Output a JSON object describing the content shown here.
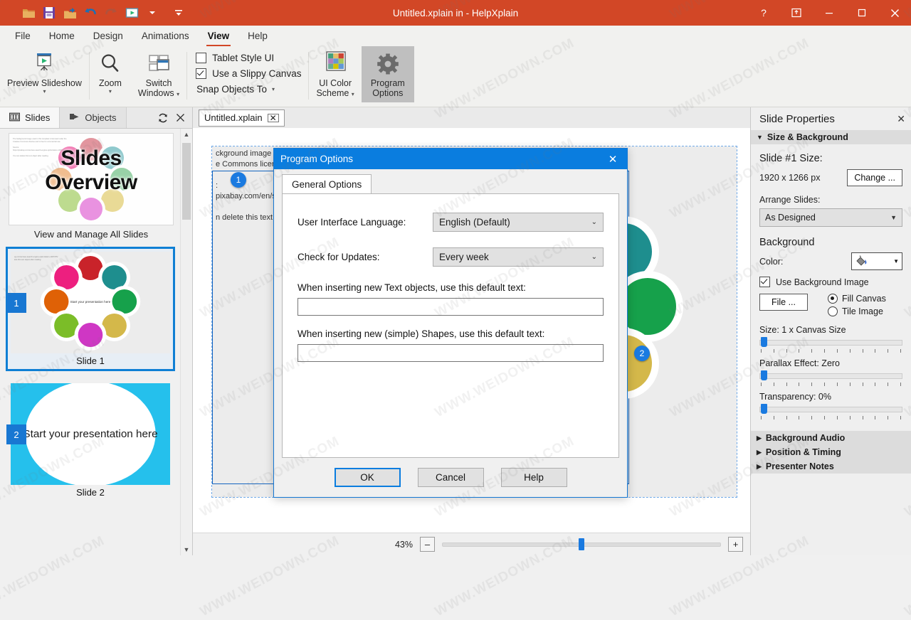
{
  "window": {
    "title": "Untitled.xplain in  - HelpXplain",
    "quick_access": [
      "open-folder-icon",
      "save-icon",
      "open-recent-icon",
      "undo-icon",
      "redo-icon",
      "slideshow-icon",
      "dropdown-caret-icon",
      "customize-qat-icon"
    ],
    "controls": {
      "help": "?",
      "restore_ribbon": "restore-ribbon-icon",
      "minimize": "–",
      "maximize": "□",
      "close": "✕"
    },
    "accent_color": "#d24726"
  },
  "ribbon": {
    "tabs": [
      {
        "label": "File",
        "active": false
      },
      {
        "label": "Home",
        "active": false
      },
      {
        "label": "Design",
        "active": false
      },
      {
        "label": "Animations",
        "active": false
      },
      {
        "label": "View",
        "active": true
      },
      {
        "label": "Help",
        "active": false
      }
    ],
    "buttons": {
      "preview_slideshow": "Preview Slideshow",
      "zoom": "Zoom",
      "switch_windows_line1": "Switch",
      "switch_windows_line2": "Windows",
      "ui_color_scheme_line1": "UI Color",
      "ui_color_scheme_line2": "Scheme",
      "program_options_line1": "Program",
      "program_options_line2": "Options"
    },
    "checkboxes": [
      {
        "label": "Tablet Style UI",
        "checked": false
      },
      {
        "label": "Use a Slippy Canvas",
        "checked": true
      }
    ],
    "snap_objects_to": "Snap Objects To",
    "color_scheme_swatches": [
      "#44a07c",
      "#e6bd69",
      "#cc4433",
      "#b07fbd",
      "#6698cf",
      "#a7c95a",
      "#69ab94",
      "#d4c400",
      "#6298d6"
    ]
  },
  "left_panel": {
    "tabs": [
      {
        "label": "Slides",
        "icon": "filmstrip-icon",
        "active": true
      },
      {
        "label": "Objects",
        "icon": "objects-icon",
        "active": false
      }
    ],
    "actions": [
      {
        "name": "refresh-icon",
        "glyph": "⟳"
      },
      {
        "name": "close-icon",
        "glyph": "✕"
      }
    ],
    "overview": {
      "title_line1": "Slides",
      "title_line2": "Overview",
      "caption": "View and Manage All Slides"
    },
    "slides": [
      {
        "number": "1",
        "caption": "Slide 1",
        "selected": true,
        "text": "Start your presentation here"
      },
      {
        "number": "2",
        "caption": "Slide 2",
        "selected": false,
        "text": "Start your presentation here"
      }
    ]
  },
  "document": {
    "tab_label": "Untitled.xplain",
    "tab_close": "✕",
    "canvas_note": "ckground image used in t\ne Commons license and i\n\n:\npixabay.com/en/seo-sear\n\nn delete this text object a",
    "marker_label": "1",
    "marker2_label": "2"
  },
  "status_bar": {
    "zoom_percent": "43%",
    "zoom_out": "–",
    "zoom_in": "+"
  },
  "right_panel": {
    "title": "Slide Properties",
    "close": "✕",
    "sections": [
      {
        "label": "Size & Background",
        "expanded": true
      },
      {
        "label": "Background Audio",
        "expanded": false
      },
      {
        "label": "Position & Timing",
        "expanded": false
      },
      {
        "label": "Presenter Notes",
        "expanded": false
      }
    ],
    "slide_size_heading": "Slide #1 Size:",
    "slide_size_value": "1920 x 1266 px",
    "change_button": "Change ...",
    "arrange_label": "Arrange Slides:",
    "arrange_value": "As Designed",
    "background_heading": "Background",
    "color_label": "Color:",
    "color_icon": "paint-bucket-icon",
    "use_background_image": {
      "label": "Use Background Image",
      "checked": true
    },
    "file_button": "File ...",
    "fill_mode": [
      {
        "label": "Fill Canvas",
        "selected": true
      },
      {
        "label": "Tile Image",
        "selected": false
      }
    ],
    "sliders": [
      {
        "label": "Size: 1 x Canvas Size",
        "value": 2
      },
      {
        "label": "Parallax Effect: Zero",
        "value": 2
      },
      {
        "label": "Transparency: 0%",
        "value": 2
      }
    ]
  },
  "dialog": {
    "title": "Program Options",
    "close": "✕",
    "tab": "General Options",
    "fields": [
      {
        "label": "User Interface Language:",
        "value": "English (Default)"
      },
      {
        "label": "Check for Updates:",
        "value": "Every week"
      }
    ],
    "text_default_label": "When inserting new Text objects, use this default text:",
    "text_default_value": "",
    "shape_default_label": "When inserting new (simple) Shapes, use this default text:",
    "shape_default_value": "",
    "buttons": [
      {
        "label": "OK",
        "default": true
      },
      {
        "label": "Cancel",
        "default": false
      },
      {
        "label": "Help",
        "default": false
      }
    ]
  },
  "watermark": "WWW.WEIDOWN.COM"
}
